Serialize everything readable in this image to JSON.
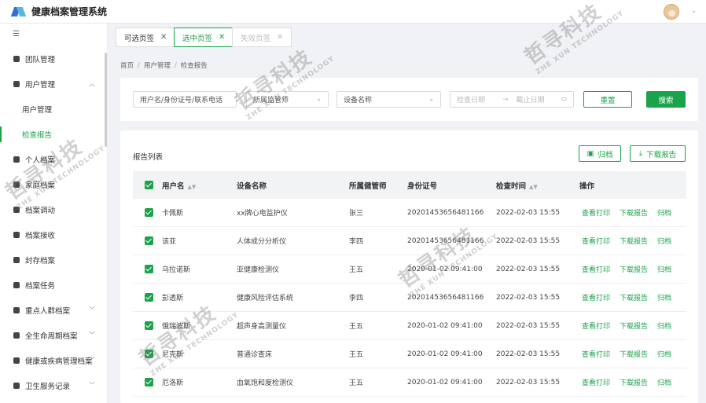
{
  "header": {
    "app_title": "健康档案管理系统"
  },
  "sidebar": {
    "items": [
      {
        "label": "团队管理",
        "icon": "home-icon"
      },
      {
        "label": "用户管理",
        "icon": "users-icon",
        "expanded": true
      },
      {
        "label": "用户管理",
        "sub": true
      },
      {
        "label": "检查报告",
        "sub": true,
        "active": true
      },
      {
        "label": "个人档案",
        "icon": "person-icon"
      },
      {
        "label": "家庭档案",
        "icon": "family-icon"
      },
      {
        "label": "档案调动",
        "icon": "transfer-icon"
      },
      {
        "label": "档案接收",
        "icon": "receive-icon"
      },
      {
        "label": "封存档案",
        "icon": "archive-icon"
      },
      {
        "label": "档案任务",
        "icon": "task-icon"
      },
      {
        "label": "重点人群档案",
        "icon": "key-group-icon",
        "has_arrow": true
      },
      {
        "label": "全生命周期档案",
        "icon": "heart-icon",
        "has_arrow": true
      },
      {
        "label": "健康或疾病管理档案",
        "icon": "record-icon",
        "has_arrow": true
      },
      {
        "label": "卫生服务记录",
        "icon": "service-icon",
        "has_arrow": true
      }
    ]
  },
  "tabs": [
    {
      "label": "可选页签",
      "state": "normal"
    },
    {
      "label": "选中页签",
      "state": "active"
    },
    {
      "label": "失效页签",
      "state": "disabled"
    }
  ],
  "breadcrumb": [
    "首页",
    "用户管理",
    "检查报告"
  ],
  "filters": {
    "user_placeholder": "用户名/身份证号/联系电话",
    "manager_placeholder": "所属监管师",
    "device_placeholder": "设备名称",
    "start_date_placeholder": "检查日期",
    "date_sep": "→",
    "end_date_placeholder": "截止日期",
    "reset_label": "重置",
    "search_label": "搜索"
  },
  "report_list": {
    "title": "报告列表",
    "archive_label": "归档",
    "download_label": "下载报告",
    "columns": [
      "用户名",
      "设备名称",
      "所属健管师",
      "身份证号",
      "检查时间",
      "操作"
    ],
    "action_view": "查看打印",
    "action_download": "下载报告",
    "action_archive": "归档",
    "rows": [
      {
        "name": "卡佩斯",
        "device": "xx牌心电监护仪",
        "manager": "张三",
        "id": "20201453656481166",
        "time": "2022-02-03 15:55"
      },
      {
        "name": "该亚",
        "device": "人体成分分析仪",
        "manager": "李四",
        "id": "20201453656481166",
        "time": "2022-02-03 15:55"
      },
      {
        "name": "乌拉诺斯",
        "device": "亚健康检测仪",
        "manager": "王五",
        "id": "2020-01-02  09:41:00",
        "time": "2022-02-03 15:55"
      },
      {
        "name": "彭透斯",
        "device": "健康风险评估系统",
        "manager": "李四",
        "id": "20201453656481166",
        "time": "2022-02-03 15:55"
      },
      {
        "name": "俄瑞波斯",
        "device": "超声身高测量仪",
        "manager": "王五",
        "id": "2020-01-02  09:41:00",
        "time": "2022-02-03 15:55"
      },
      {
        "name": "尼克斯",
        "device": "普通诊查床",
        "manager": "王五",
        "id": "2020-01-02  09:41:00",
        "time": "2022-02-03 15:55"
      },
      {
        "name": "厄洛斯",
        "device": "血氧饱和度检测仪",
        "manager": "王五",
        "id": "2020-01-02  09:41:00",
        "time": "2022-02-03 15:55"
      }
    ]
  },
  "watermark": {
    "text": "哲寻科技",
    "sub": "ZHE XUN TECHNOLOGY"
  },
  "colors": {
    "accent": "#1aa34a",
    "logo_blue": "#2f6fd6"
  }
}
